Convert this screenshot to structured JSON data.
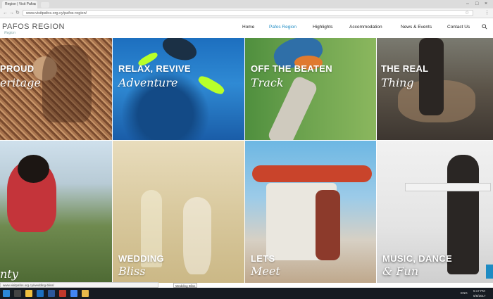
{
  "browser": {
    "tab_title": "Region | Visit Pafos",
    "url": "www.visitpafos.org.cy/pafos-region/"
  },
  "site": {
    "logo_text": "PAFOS REGION",
    "logo_sub": "Region",
    "nav": [
      {
        "label": "Home"
      },
      {
        "label": "Pafos Region"
      },
      {
        "label": "Highlights"
      },
      {
        "label": "Accommodation"
      },
      {
        "label": "News & Events"
      },
      {
        "label": "Contact Us"
      }
    ],
    "active_nav": "Pafos Region",
    "accent_color": "#1e8bc3"
  },
  "tiles": [
    {
      "line1": "PROUD",
      "line2": "eritage"
    },
    {
      "line1": "RELAX, REVIVE",
      "line2": "Adventure"
    },
    {
      "line1": "OFF THE BEATEN",
      "line2": "Track"
    },
    {
      "line1": "THE REAL",
      "line2": "Thing"
    },
    {
      "line1": "",
      "line2": "nty"
    },
    {
      "line1": "WEDDING",
      "line2": "Bliss"
    },
    {
      "line1": "LETS",
      "line2": "Meet"
    },
    {
      "line1": "MUSIC, DANCE",
      "line2": "& Fun"
    }
  ],
  "status": {
    "link_preview": "www.visitpafos.org.cy/wedding-bliss/",
    "tooltip": "Wedding Bliss"
  },
  "taskbar": {
    "lang": "ENG",
    "time": "5:17 PM",
    "date": "5/8/2017"
  }
}
